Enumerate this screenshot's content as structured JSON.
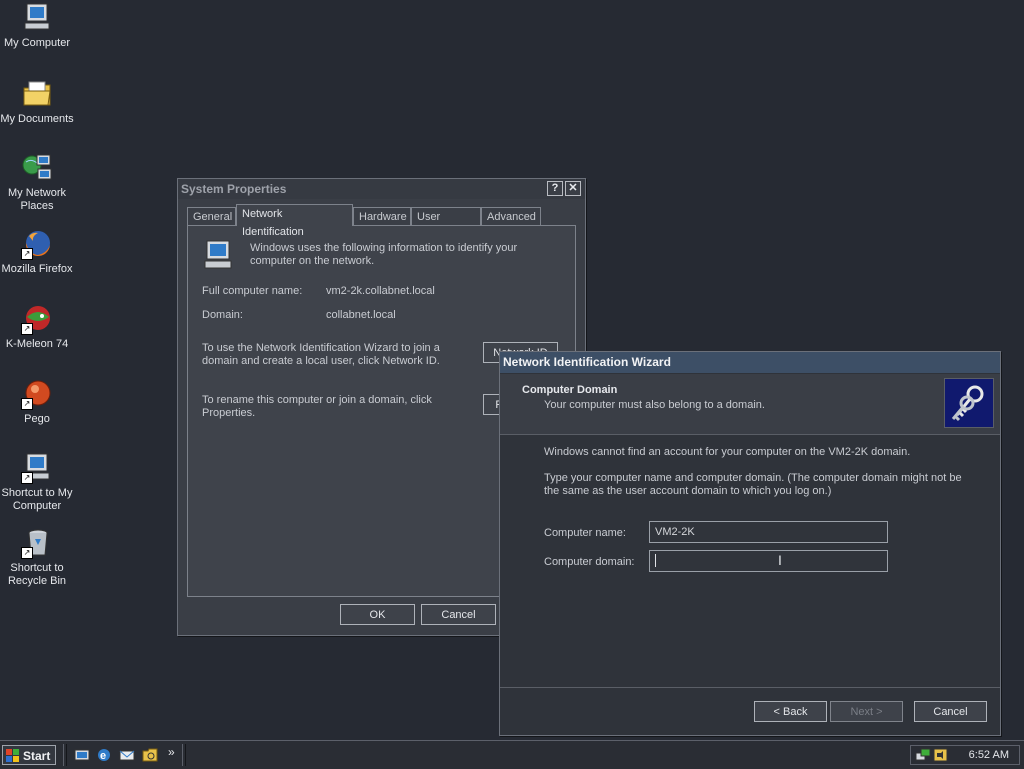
{
  "desktop": {
    "icons": [
      {
        "label": "My Computer",
        "icon": "computer-icon"
      },
      {
        "label": "My Documents",
        "icon": "folder-icon"
      },
      {
        "label": "My Network Places",
        "icon": "network-icon"
      },
      {
        "label": "Mozilla Firefox",
        "icon": "firefox-icon"
      },
      {
        "label": "K-Meleon 74",
        "icon": "kmeleon-icon"
      },
      {
        "label": "Pego",
        "icon": "pego-icon"
      },
      {
        "label": "Shortcut to My Computer",
        "icon": "computer-icon"
      },
      {
        "label": "Shortcut to Recycle Bin",
        "icon": "recycle-bin-icon"
      }
    ]
  },
  "system_properties": {
    "title": "System Properties",
    "help_btn": "?",
    "close_btn": "✕",
    "tabs": {
      "general": "General",
      "network": "Network Identification",
      "hardware": "Hardware",
      "user_profiles": "User Profiles",
      "advanced": "Advanced"
    },
    "intro": "Windows uses the following information to identify your computer on the network.",
    "full_name_label": "Full computer name:",
    "full_name_value": "vm2-2k.collabnet.local",
    "domain_label": "Domain:",
    "domain_value": "collabnet.local",
    "wizard_text": "To use the Network Identification Wizard to join a domain and create a local user, click Network ID.",
    "network_id_btn": "Network ID",
    "rename_text": "To rename this computer or join a domain, click Properties.",
    "properties_btn": "Properties",
    "ok_btn": "OK",
    "cancel_btn": "Cancel"
  },
  "wizard": {
    "title": "Network Identification Wizard",
    "header_title": "Computer Domain",
    "header_subtitle": "Your computer must also belong to a domain.",
    "message1": "Windows cannot find an account for your computer on the VM2-2K domain.",
    "message2": "Type your computer name and computer domain. (The computer domain might not be the same as the user account domain to which you log on.)",
    "computer_name_label": "Computer name:",
    "computer_name_value": "VM2-2K",
    "computer_domain_label": "Computer domain:",
    "computer_domain_value": "",
    "back_btn": "< Back",
    "next_btn": "Next >",
    "cancel_btn": "Cancel"
  },
  "taskbar": {
    "start_label": "Start",
    "chevron": "»",
    "clock": "6:52 AM"
  }
}
